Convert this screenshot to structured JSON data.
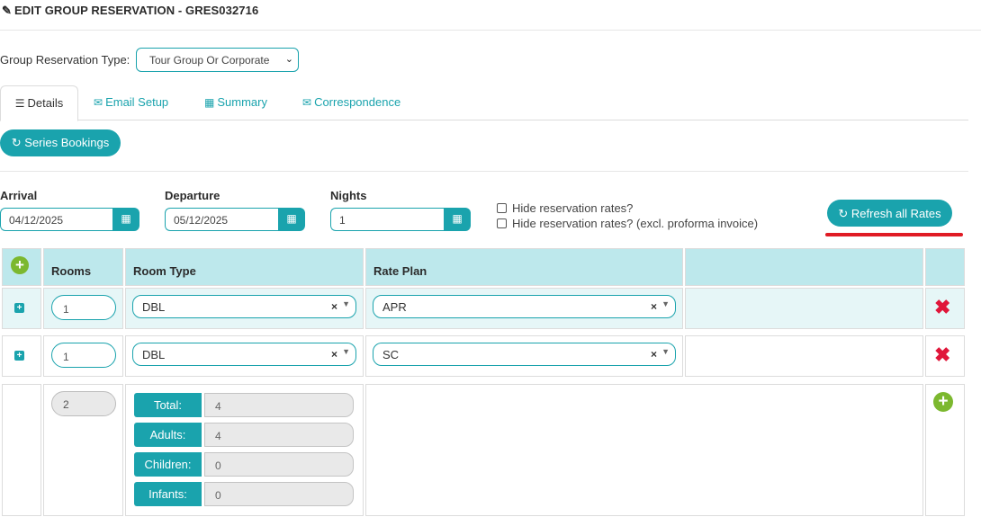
{
  "header": {
    "title": "EDIT GROUP RESERVATION - GRES032716"
  },
  "group_type": {
    "label": "Group Reservation Type:",
    "value": "Tour Group Or Corporate"
  },
  "tabs": [
    {
      "label": "Details",
      "icon": "list-icon"
    },
    {
      "label": "Email Setup",
      "icon": "envelope-icon"
    },
    {
      "label": "Summary",
      "icon": "grid-icon"
    },
    {
      "label": "Correspondence",
      "icon": "envelope-icon"
    }
  ],
  "series_button": {
    "label": "Series Bookings"
  },
  "dates": {
    "arrival_label": "Arrival",
    "arrival_value": "04/12/2025",
    "departure_label": "Departure",
    "departure_value": "05/12/2025",
    "nights_label": "Nights",
    "nights_value": "1"
  },
  "options": {
    "hide_rates": "Hide reservation rates?",
    "hide_rates_excl": "Hide reservation rates? (excl. proforma invoice)"
  },
  "refresh_button": {
    "label": "Refresh all Rates"
  },
  "table": {
    "headers": {
      "rooms": "Rooms",
      "room_type": "Room Type",
      "rate_plan": "Rate Plan"
    },
    "rows": [
      {
        "rooms": "1",
        "room_type": "DBL",
        "rate_plan": "APR"
      },
      {
        "rooms": "1",
        "room_type": "DBL",
        "rate_plan": "SC"
      }
    ],
    "totals": {
      "rooms": "2",
      "total_label": "Total:",
      "total_value": "4",
      "adults_label": "Adults:",
      "adults_value": "4",
      "children_label": "Children:",
      "children_value": "0",
      "infants_label": "Infants:",
      "infants_value": "0"
    }
  },
  "colors": {
    "accent": "#1aa3ad",
    "header_bg": "#bde8ec",
    "delete": "#e0163a",
    "add": "#7cb82f",
    "highlight": "#e01b24"
  }
}
